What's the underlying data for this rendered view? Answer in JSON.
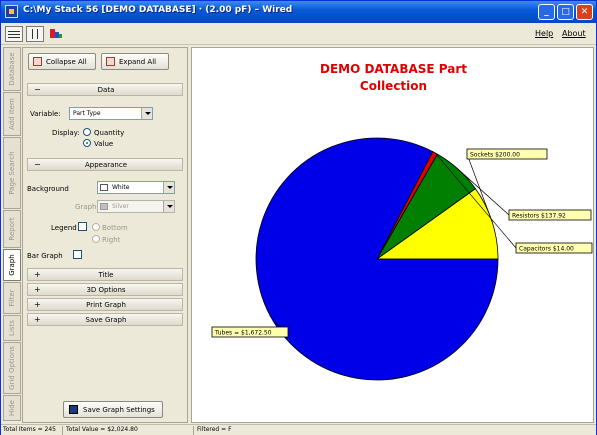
{
  "window": {
    "title": "C:\\My Stack 56 [DEMO DATABASE] · (2.00 pF) – Wired",
    "caption_buttons": {
      "minimize": "_",
      "maximize": "□",
      "close": "✕"
    }
  },
  "menubar": {
    "help": "Help",
    "about": "About"
  },
  "side_tabs": [
    "Database",
    "Add Item",
    "Page Search",
    "Report",
    "Graph",
    "Filter",
    "Lists",
    "Grid Options",
    "Hide"
  ],
  "panel": {
    "collapse_all": "Collapse All",
    "expand_all": "Expand All",
    "data_section": {
      "glyph": "−",
      "title": "Data"
    },
    "variable_label": "Variable:",
    "variable_value": "Part Type",
    "display_label": "Display:",
    "display_options": [
      "Quantity",
      "Value"
    ],
    "display_selected": "Value",
    "appearance_section": {
      "glyph": "−",
      "title": "Appearance"
    },
    "background_label": "Background",
    "background_value": "White",
    "graph_label": "Graph",
    "graph_value": "Silver",
    "legend_label": "Legend",
    "legend_options": [
      "Bottom",
      "Right"
    ],
    "bar_graph_label": "Bar Graph",
    "collapsed_sections": [
      {
        "glyph": "+",
        "title": "Title"
      },
      {
        "glyph": "+",
        "title": "3D Options"
      },
      {
        "glyph": "+",
        "title": "Print Graph"
      },
      {
        "glyph": "+",
        "title": "Save Graph"
      }
    ],
    "save_settings": "Save Graph Settings"
  },
  "chart_data": {
    "type": "pie",
    "title_line1": "DEMO DATABASE Part",
    "title_line2": "Collection",
    "slices": [
      {
        "label": "Sockets $200.00",
        "value": 200.0,
        "color": "#ffff00"
      },
      {
        "label": "Resistors $137.92",
        "value": 137.92,
        "color": "#007f00"
      },
      {
        "label": "Capacitors $14.00",
        "value": 14.0,
        "color": "#e00000"
      },
      {
        "label": "Tubes = $1,672.50",
        "value": 1672.5,
        "color": "#0000e8"
      }
    ]
  },
  "statusbar": {
    "total_items": "Total Items = 245",
    "total_value": "Total Value = $2,024.80",
    "filtered": "Filtered = F"
  }
}
